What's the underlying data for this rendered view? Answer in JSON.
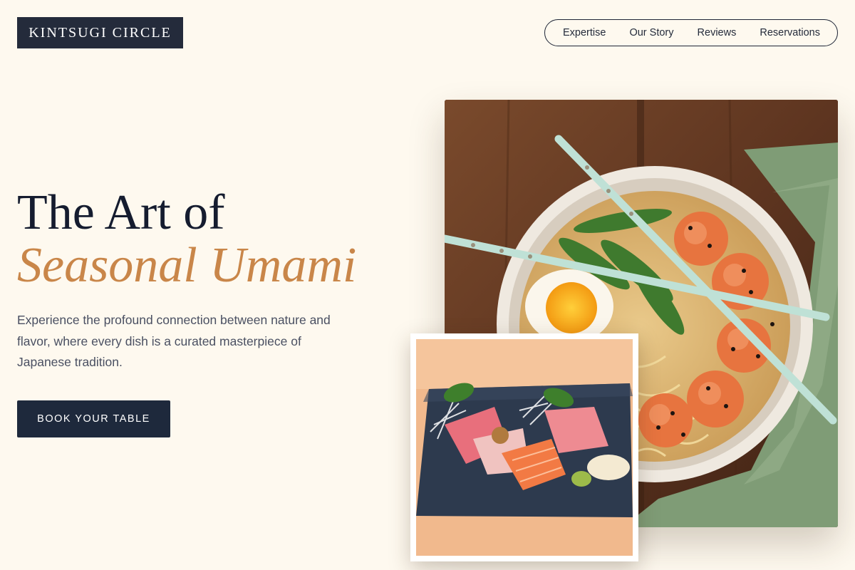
{
  "brand": {
    "name": "KINTSUGI CIRCLE"
  },
  "nav": {
    "items": [
      "Expertise",
      "Our Story",
      "Reviews",
      "Reservations"
    ]
  },
  "hero": {
    "title_line1": "The Art of",
    "title_line2": "Seasonal Umami",
    "description": "Experience the profound connection between nature and flavor, where every dish is a curated masterpiece of Japanese tradition.",
    "cta_label": "BOOK YOUR TABLE"
  },
  "colors": {
    "background": "#fef9ef",
    "primary_dark": "#1e293c",
    "accent": "#c98649"
  }
}
